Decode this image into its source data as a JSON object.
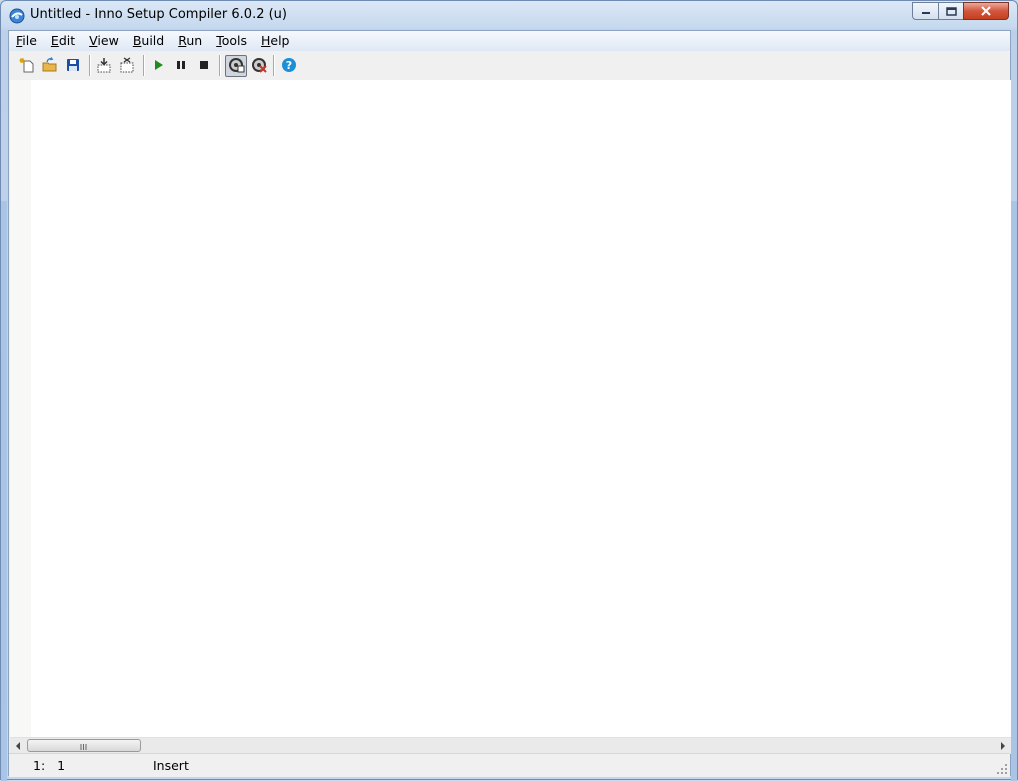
{
  "window": {
    "title": "Untitled - Inno Setup Compiler 6.0.2 (u)"
  },
  "menu": [
    {
      "label": "File",
      "underline": "F",
      "rest": "ile"
    },
    {
      "label": "Edit",
      "underline": "E",
      "rest": "dit"
    },
    {
      "label": "View",
      "underline": "V",
      "rest": "iew"
    },
    {
      "label": "Build",
      "underline": "B",
      "rest": "uild"
    },
    {
      "label": "Run",
      "underline": "R",
      "rest": "un"
    },
    {
      "label": "Tools",
      "underline": "T",
      "rest": "ools"
    },
    {
      "label": "Help",
      "underline": "H",
      "rest": "elp"
    }
  ],
  "toolbar": {
    "icons": [
      "new-file-icon",
      "open-file-icon",
      "save-icon",
      "compile-icon",
      "stop-compile-icon",
      "run-icon",
      "pause-icon",
      "stop-icon",
      "target-setup-icon",
      "target-uninstall-icon",
      "help-icon"
    ]
  },
  "status": {
    "position": "1:   1",
    "mode": "Insert"
  },
  "colors": {
    "run_green": "#1e8c1e",
    "save_blue": "#1a4fa3",
    "help_blue": "#1c8fd6"
  }
}
